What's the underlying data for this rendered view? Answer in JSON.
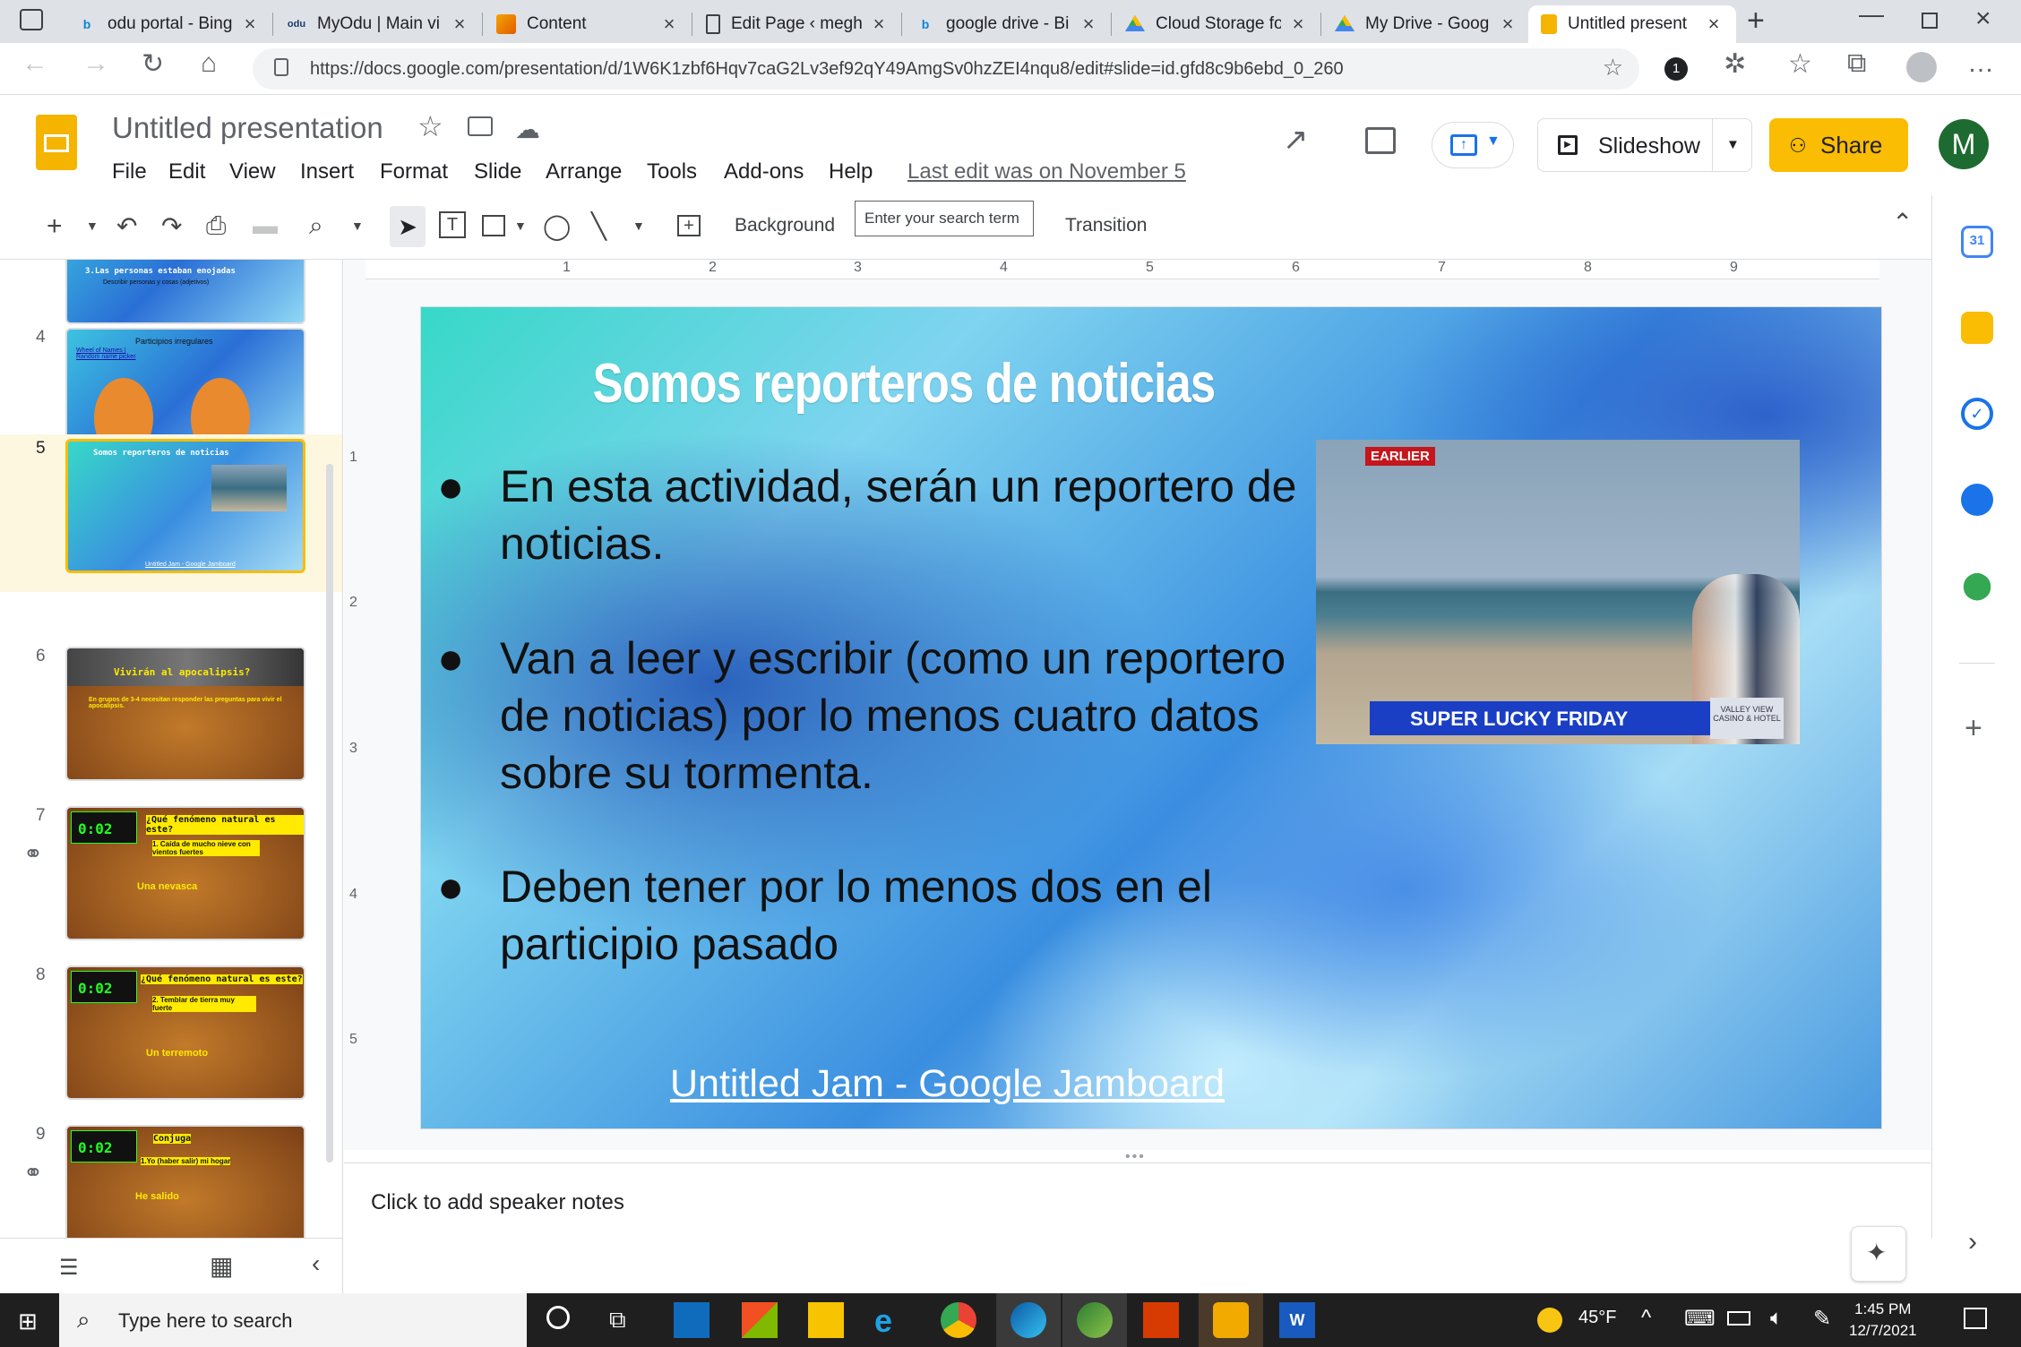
{
  "browser": {
    "tabs": [
      {
        "title": "odu portal - Bing",
        "icon": "bing-icon"
      },
      {
        "title": "MyOdu | Main vi",
        "icon": "odu-icon"
      },
      {
        "title": "Content",
        "icon": "content-icon"
      },
      {
        "title": "Edit Page ‹ megh",
        "icon": "page-icon"
      },
      {
        "title": "google drive - Bi",
        "icon": "bing-icon"
      },
      {
        "title": "Cloud Storage fo",
        "icon": "drive-icon"
      },
      {
        "title": "My Drive - Goog",
        "icon": "drive-icon"
      },
      {
        "title": "Untitled present",
        "icon": "slides-icon"
      }
    ],
    "url": "https://docs.google.com/presentation/d/1W6K1zbf6Hqv7caG2Lv3ef92qY49AmgSv0hzZEI4nqu8/edit#slide=id.gfd8c9b6ebd_0_260",
    "notification_count": "1"
  },
  "docs": {
    "title": "Untitled presentation",
    "menus": [
      "File",
      "Edit",
      "View",
      "Insert",
      "Format",
      "Slide",
      "Arrange",
      "Tools",
      "Add-ons",
      "Help"
    ],
    "last_edit": "Last edit was on November 5",
    "slideshow_label": "Slideshow",
    "share_label": "Share",
    "avatar_letter": "M"
  },
  "toolbar": {
    "background_label": "Background",
    "tooltip": "Enter your search term",
    "transition_label": "Transition"
  },
  "ruler": {
    "h_ticks": [
      "1",
      "2",
      "3",
      "4",
      "5",
      "6",
      "7",
      "8",
      "9"
    ],
    "v_ticks": [
      "1",
      "2",
      "3",
      "4",
      "5"
    ]
  },
  "filmstrip": {
    "slides": [
      {
        "num": "",
        "title": "3.Las personas estaban enojadas",
        "sub": "Describir personas y cosas (adjetivos)"
      },
      {
        "num": "4",
        "title": "Participios irregulares",
        "sub": "Wheel of Names | Random name picker"
      },
      {
        "num": "5",
        "title": "Somos reporteros de noticias",
        "sub": "Untitled Jam - Google Jamboard"
      },
      {
        "num": "6",
        "title": "Vivirán al apocalipsis?",
        "sub": "En grupos de 3-4 necesitan responder las preguntas para vivir el apocalipsis."
      },
      {
        "num": "7",
        "title": "¿Qué fenómeno natural es este?",
        "sub": "1. Caída de mucho nieve con vientos fuertes",
        "answer": "Una nevasca",
        "timer": "0:02"
      },
      {
        "num": "8",
        "title": "¿Qué fenómeno natural es este?",
        "sub": "2. Temblar de tierra muy fuerte",
        "answer": "Un terremoto",
        "timer": "0:02"
      },
      {
        "num": "9",
        "title": "Conjuga",
        "sub": "1.Yo (haber salir) mi hogar",
        "answer": "He salido",
        "timer": "0:02"
      }
    ]
  },
  "slide": {
    "title": "Somos reporteros de noticias",
    "bullets": [
      "En esta actividad, serán un reportero de noticias.",
      "Van a leer y escribir (como un reportero de noticias) por lo menos cuatro datos sobre su tormenta.",
      "Deben tener por lo menos dos en el participio pasado"
    ],
    "link": "Untitled Jam - Google Jamboard",
    "image": {
      "earlier_label": "EARLIER",
      "lower_third": "SUPER LUCKY FRIDAY",
      "logo_text": "VALLEY VIEW CASINO & HOTEL"
    }
  },
  "notes": {
    "placeholder": "Click to add speaker notes"
  },
  "taskbar": {
    "search_placeholder": "Type here to search",
    "weather": "45°F",
    "time": "1:45 PM",
    "date": "12/7/2021"
  }
}
